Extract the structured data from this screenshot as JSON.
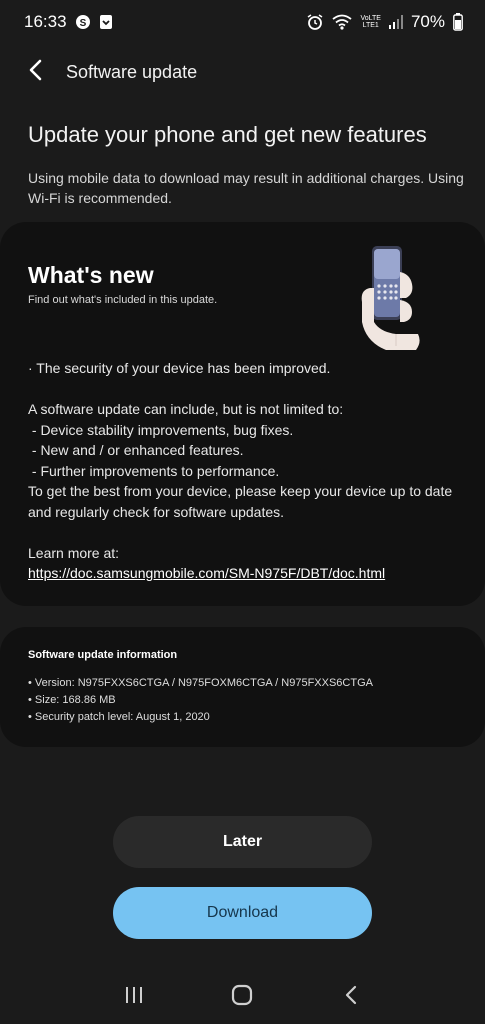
{
  "status_bar": {
    "time": "16:33",
    "battery": "70%",
    "network_volte": "VoLTE",
    "network_lte": "LTE1",
    "icons": [
      "notification-s-icon",
      "download-icon",
      "alarm-icon",
      "wifi-icon",
      "signal-icon",
      "battery-icon"
    ]
  },
  "appbar": {
    "title": "Software update",
    "back_icon": "back-arrow-icon"
  },
  "intro": {
    "headline": "Update your phone and get new features",
    "note": "Using mobile data to download may result in additional charges. Using Wi-Fi is recommended."
  },
  "whats_new": {
    "title": "What's new",
    "subtitle": "Find out what's included in this update.",
    "lines": [
      "· The security of your device has been improved.",
      "",
      "A software update can include, but is not limited to:",
      " - Device stability improvements, bug fixes.",
      " - New and / or enhanced features.",
      " - Further improvements to performance.",
      "To get the best from your device, please keep your device up to date",
      "and regularly check for software updates.",
      "",
      "Learn more at:"
    ],
    "link": "https://doc.samsungmobile.com/SM-N975F/DBT/doc.html"
  },
  "update_info": {
    "title": "Software update information",
    "version": "• Version: N975FXXS6CTGA / N975FOXM6CTGA / N975FXXS6CTGA",
    "size": "• Size: 168.86 MB",
    "patch": "• Security patch level: August 1, 2020"
  },
  "buttons": {
    "later": "Later",
    "download": "Download"
  },
  "navbar": {
    "icons": [
      "recents-icon",
      "home-icon",
      "back-icon"
    ]
  },
  "colors": {
    "background": "#1b1b1b",
    "card": "#111111",
    "download_button": "#76c3f2",
    "later_button": "#2a2a2a"
  }
}
